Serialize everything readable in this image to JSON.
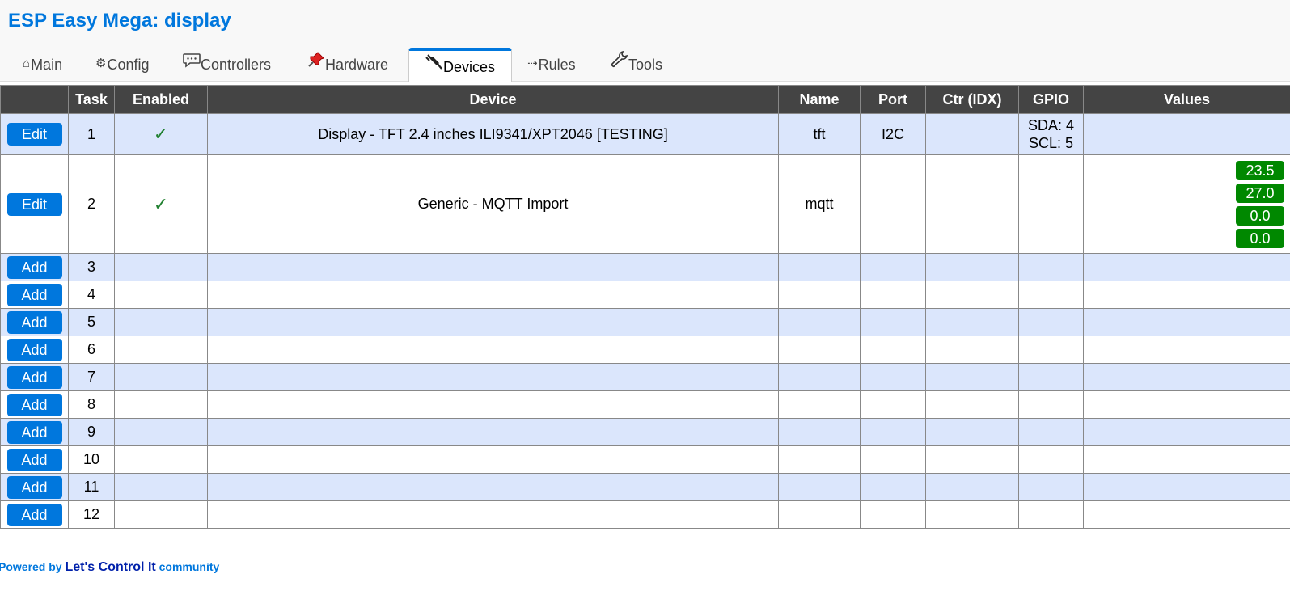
{
  "header": {
    "title": "ESP Easy Mega: display"
  },
  "tabs": [
    {
      "icon": "home-icon",
      "glyph": "⌂",
      "label": "Main",
      "active": false
    },
    {
      "icon": "gear-icon",
      "glyph": "⚙",
      "label": "Config",
      "active": false
    },
    {
      "icon": "chat-icon",
      "glyph": "",
      "label": "Controllers",
      "active": false
    },
    {
      "icon": "pushpin-icon",
      "glyph": "",
      "label": "Hardware",
      "active": false
    },
    {
      "icon": "plug-icon",
      "glyph": "",
      "label": "Devices",
      "active": true
    },
    {
      "icon": "arrow-icon",
      "glyph": "⇢",
      "label": "Rules",
      "active": false
    },
    {
      "icon": "wrench-icon",
      "glyph": "",
      "label": "Tools",
      "active": false
    }
  ],
  "table": {
    "headers": [
      "",
      "Task",
      "Enabled",
      "Device",
      "Name",
      "Port",
      "Ctr (IDX)",
      "GPIO",
      "Values"
    ],
    "rows": [
      {
        "button": "Edit",
        "task": "1",
        "enabled": "✓",
        "device": "Display - TFT 2.4 inches ILI9341/XPT2046 [TESTING]",
        "name": "tft",
        "port": "I2C",
        "ctr": "",
        "gpio": [
          "SDA: 4",
          "SCL: 5"
        ],
        "values": []
      },
      {
        "button": "Edit",
        "task": "2",
        "enabled": "✓",
        "device": "Generic - MQTT Import",
        "name": "mqtt",
        "port": "",
        "ctr": "",
        "gpio": [],
        "values": [
          "23.5",
          "27.0",
          "0.0",
          "0.0"
        ]
      },
      {
        "button": "Add",
        "task": "3"
      },
      {
        "button": "Add",
        "task": "4"
      },
      {
        "button": "Add",
        "task": "5"
      },
      {
        "button": "Add",
        "task": "6"
      },
      {
        "button": "Add",
        "task": "7"
      },
      {
        "button": "Add",
        "task": "8"
      },
      {
        "button": "Add",
        "task": "9"
      },
      {
        "button": "Add",
        "task": "10"
      },
      {
        "button": "Add",
        "task": "11"
      },
      {
        "button": "Add",
        "task": "12"
      }
    ]
  },
  "footer": {
    "prefix": "Powered by ",
    "link": "Let's Control It",
    "suffix": " community"
  },
  "colors": {
    "accent": "#0077dd",
    "header_bg": "#444444",
    "row_alt": "#dbe6fc",
    "value_badge": "#008800",
    "check": "#208030"
  }
}
